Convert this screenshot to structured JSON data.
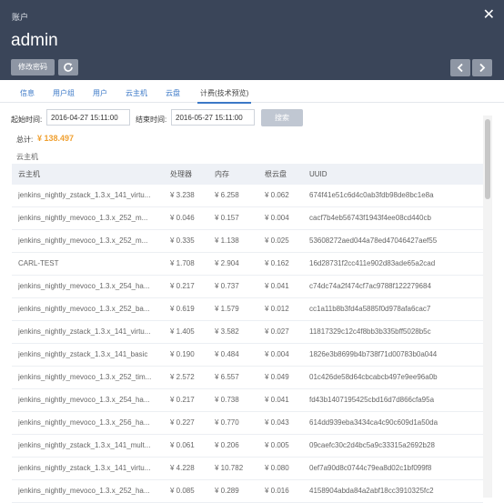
{
  "header": {
    "label": "账户",
    "title": "admin",
    "edit_password": "修改密码",
    "close_icon": "close-icon",
    "refresh_icon": "refresh-icon"
  },
  "tabs": [
    "信息",
    "用户组",
    "用户",
    "云主机",
    "云盘",
    "计费(技术预览)"
  ],
  "filter": {
    "start_label": "起始时间:",
    "start_value": "2016-04-27 15:11:00",
    "end_label": "结束时间:",
    "end_value": "2016-05-27 15:11:00",
    "search_button": "搜索"
  },
  "total": {
    "label": "总计:",
    "value": "¥ 138.497"
  },
  "section_label": "云主机",
  "table": {
    "headers": [
      "云主机",
      "处理器",
      "内存",
      "根云盘",
      "UUID"
    ],
    "rows": [
      [
        "jenkins_nightly_zstack_1.3.x_141_virtu...",
        "¥ 3.238",
        "¥ 6.258",
        "¥ 0.062",
        "674f41e51c6d4c0ab3fdb98de8bc1e8a"
      ],
      [
        "jenkins_nightly_mevoco_1.3.x_252_m...",
        "¥ 0.046",
        "¥ 0.157",
        "¥ 0.004",
        "cacf7b4eb56743f1943f4ee08cd440cb"
      ],
      [
        "jenkins_nightly_mevoco_1.3.x_252_m...",
        "¥ 0.335",
        "¥ 1.138",
        "¥ 0.025",
        "53608272aed044a78ed47046427aef55"
      ],
      [
        "CARL-TEST",
        "¥ 1.708",
        "¥ 2.904",
        "¥ 0.162",
        "16d28731f2cc411e902d83ade65a2cad"
      ],
      [
        "jenkins_nightly_mevoco_1.3.x_254_ha...",
        "¥ 0.217",
        "¥ 0.737",
        "¥ 0.041",
        "c74dc74a2f474cf7ac9788f122279684"
      ],
      [
        "jenkins_nightly_mevoco_1.3.x_252_ba...",
        "¥ 0.619",
        "¥ 1.579",
        "¥ 0.012",
        "cc1a11b8b3fd4a5885f0d978afa6cac7"
      ],
      [
        "jenkins_nightly_zstack_1.3.x_141_virtu...",
        "¥ 1.405",
        "¥ 3.582",
        "¥ 0.027",
        "11817329c12c4f8bb3b335bff5028b5c"
      ],
      [
        "jenkins_nightly_zstack_1.3.x_141_basic",
        "¥ 0.190",
        "¥ 0.484",
        "¥ 0.004",
        "1826e3b8699b4b738f71d00783b0a044"
      ],
      [
        "jenkins_nightly_mevoco_1.3.x_252_tim...",
        "¥ 2.572",
        "¥ 6.557",
        "¥ 0.049",
        "01c426de58d64cbcabcb497e9ee96a0b"
      ],
      [
        "jenkins_nightly_mevoco_1.3.x_254_ha...",
        "¥ 0.217",
        "¥ 0.738",
        "¥ 0.041",
        "fd43b1407195425cbd16d7d866cfa95a"
      ],
      [
        "jenkins_nightly_mevoco_1.3.x_256_ha...",
        "¥ 0.227",
        "¥ 0.770",
        "¥ 0.043",
        "614dd939eba3434ca4c90c609d1a50da"
      ],
      [
        "jenkins_nightly_zstack_1.3.x_141_mult...",
        "¥ 0.061",
        "¥ 0.206",
        "¥ 0.005",
        "09caefc30c2d4bc5a9c33315a2692b28"
      ],
      [
        "jenkins_nightly_zstack_1.3.x_141_virtu...",
        "¥ 4.228",
        "¥ 10.782",
        "¥ 0.080",
        "0ef7a90d8c0744c79ea8d02c1bf099f8"
      ],
      [
        "jenkins_nightly_mevoco_1.3.x_252_ha...",
        "¥ 0.085",
        "¥ 0.289",
        "¥ 0.016",
        "4158904abda84a2abf18cc3910325fc2"
      ]
    ]
  }
}
